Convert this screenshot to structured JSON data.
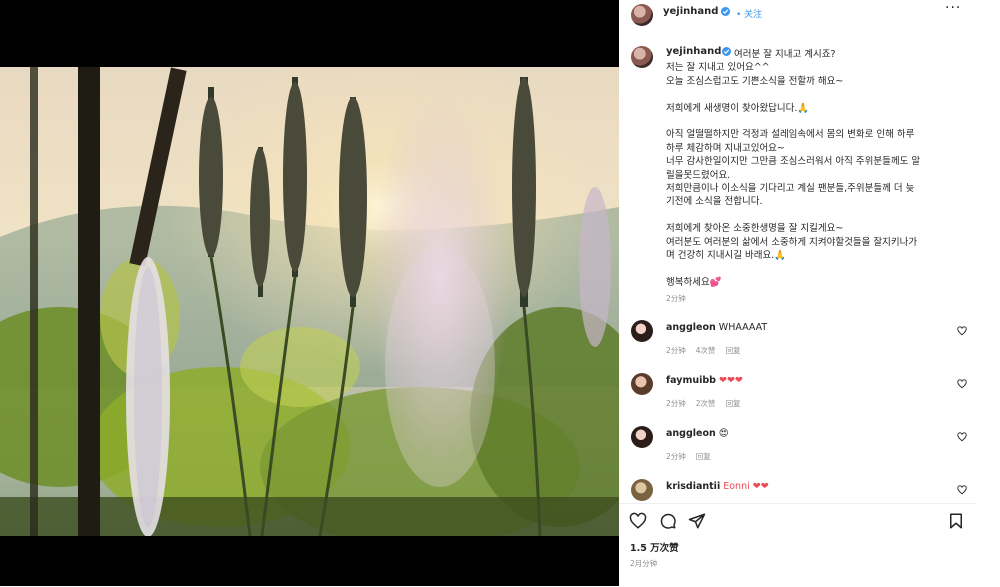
{
  "post": {
    "author": "yejinhand",
    "follow_label": "关注",
    "more_icon": "more-dots-icon",
    "caption_lines": [
      "여러분 잘 지내고 계시죠?",
      "저는 잘 지내고 있어요^^",
      "오늘 조심스럽고도 기쁜소식을 전할까 해요~",
      "",
      "저희에게 새생명이 찾아왔답니다.🙏",
      "",
      "아직 얼떨떨하지만 걱정과 설레임속에서 몸의 변화로 인해 하루",
      "하루 체감하며 지내고있어요~",
      "너무 감사한일이지만 그만큼 조심스러워서 아직 주위분들께도 알",
      "릴을못드렸어요.",
      "저희만큼이나 이소식을 기다리고 계실 팬분들,주위분들께 더 늦",
      "기전에 소식을 전합니다.",
      "",
      "저희에게 찾아온 소중한생명을 잘 지킬게요~",
      "여러분도 여러분의 삶에서 소중하게 지켜야할것들을 잘지키나가",
      "며 건강히 지내시길 바래요.🙏",
      "",
      "행복하세요💕"
    ],
    "caption_time": "2分钟",
    "likes": "1.5 万次赞",
    "date": "2月分钟"
  },
  "comments": [
    {
      "user": "anggleon",
      "text": "WHAAAAT",
      "time": "2分钟",
      "likes": "4次赞",
      "reply": "回复"
    },
    {
      "user": "faymuibb",
      "text": "❤❤❤",
      "time": "2分钟",
      "likes": "2次赞",
      "reply": "回复"
    },
    {
      "user": "anggleon",
      "text": "😍",
      "time": "2分钟",
      "likes": "",
      "reply": "回复"
    },
    {
      "user": "krisdiantii",
      "text": "Eonni ❤❤",
      "time": "",
      "likes": "",
      "reply": ""
    }
  ],
  "colors": {
    "accent": "#3897f0",
    "heart": "#ed4956",
    "text": "#262626",
    "muted": "#8e8e8e"
  }
}
